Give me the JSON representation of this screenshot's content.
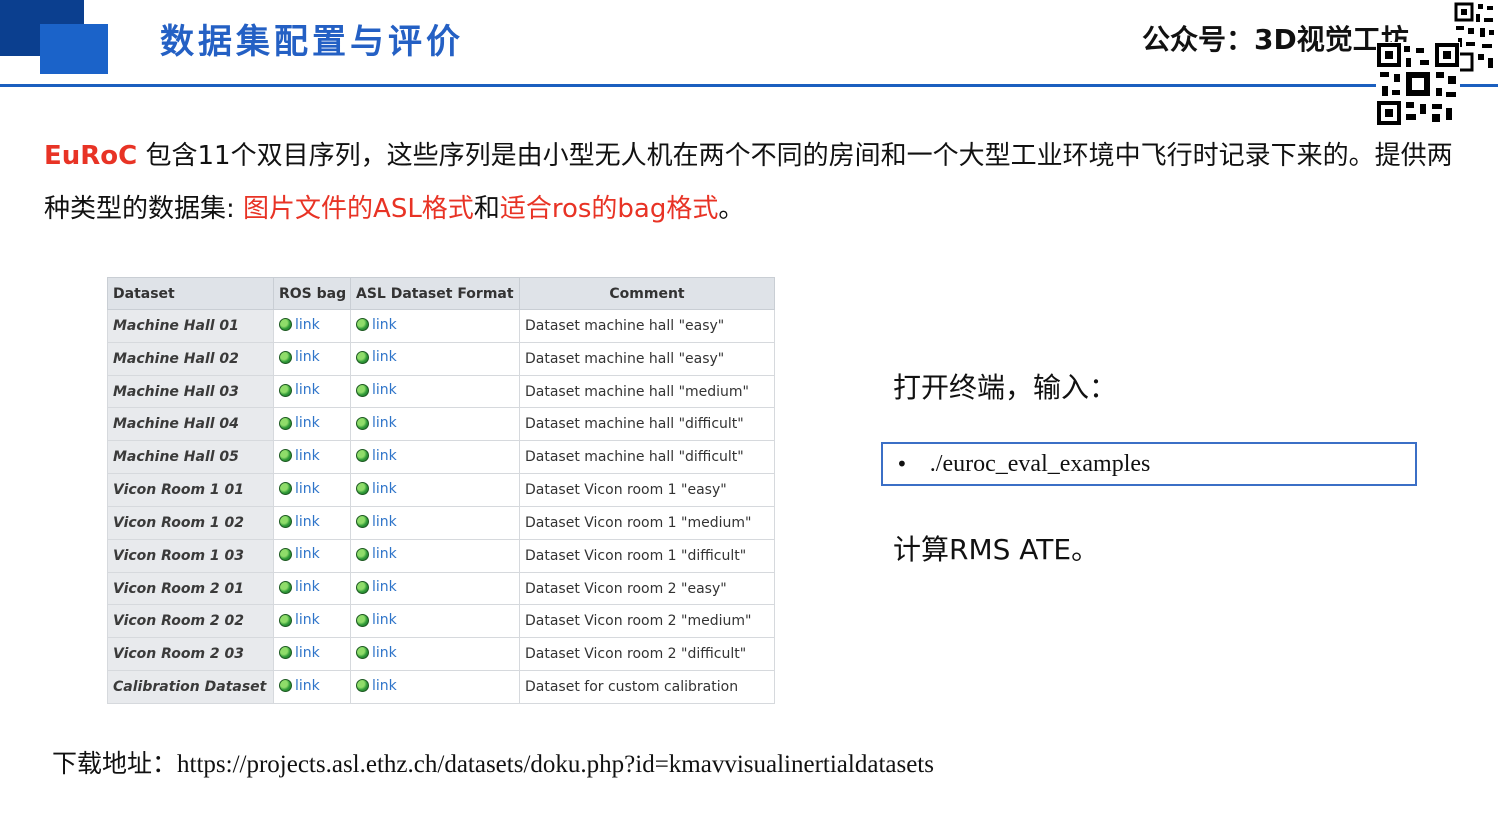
{
  "header": {
    "title": "数据集配置与评价",
    "watermark": "公众号：3D视觉工坊"
  },
  "intro": {
    "brand": "EuRoC",
    "text_1": " 包含11个双目序列，这些序列是由小型无人机在两个不同的房间和一个大型工业环境中飞行时记录下来的。提供两种类型的数据集: ",
    "highlight_1": "图片文件的ASL格式",
    "text_2": "和",
    "highlight_2": "适合ros的bag格式",
    "text_3": "。"
  },
  "table": {
    "headers": [
      "Dataset",
      "ROS bag",
      "ASL Dataset Format",
      "Comment"
    ],
    "link_label": "link",
    "link_icon": "globe-icon",
    "rows": [
      {
        "name": "Machine Hall 01",
        "comment": "Dataset machine hall \"easy\""
      },
      {
        "name": "Machine Hall 02",
        "comment": "Dataset machine hall \"easy\""
      },
      {
        "name": "Machine Hall 03",
        "comment": "Dataset machine hall \"medium\""
      },
      {
        "name": "Machine Hall 04",
        "comment": "Dataset machine hall \"difficult\""
      },
      {
        "name": "Machine Hall 05",
        "comment": "Dataset machine hall \"difficult\""
      },
      {
        "name": "Vicon Room 1 01",
        "comment": "Dataset Vicon room 1 \"easy\""
      },
      {
        "name": "Vicon Room 1 02",
        "comment": "Dataset Vicon room 1 \"medium\""
      },
      {
        "name": "Vicon Room 1 03",
        "comment": "Dataset Vicon room 1 \"difficult\""
      },
      {
        "name": "Vicon Room 2 01",
        "comment": "Dataset Vicon room 2 \"easy\""
      },
      {
        "name": "Vicon Room 2 02",
        "comment": "Dataset Vicon room 2 \"medium\""
      },
      {
        "name": "Vicon Room 2 03",
        "comment": "Dataset Vicon room 2 \"difficult\""
      },
      {
        "name": "Calibration Dataset",
        "comment": "Dataset for custom calibration"
      }
    ]
  },
  "right_panel": {
    "terminal_label": "打开终端，输入：",
    "bullet": "•",
    "command": "./euroc_eval_examples",
    "rms_label": "计算RMS ATE。"
  },
  "download": {
    "label": "下载地址：",
    "url": "https://projects.asl.ethz.ch/datasets/doku.php?id=kmavvisualinertialdatasets"
  },
  "colors": {
    "accent_blue": "#1b63c9",
    "title_blue": "#2460c4",
    "highlight_red": "#e83325",
    "link_blue": "#2e74c9"
  }
}
